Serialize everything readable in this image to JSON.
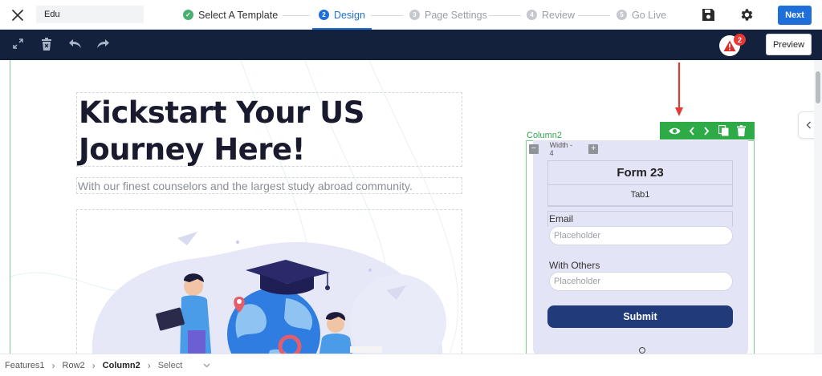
{
  "header": {
    "page_name_value": "Edu",
    "steps": [
      {
        "number": "",
        "label": "Select A Template",
        "state": "done"
      },
      {
        "number": "2",
        "label": "Design",
        "state": "active"
      },
      {
        "number": "3",
        "label": "Page Settings",
        "state": "pending"
      },
      {
        "number": "4",
        "label": "Review",
        "state": "pending"
      },
      {
        "number": "5",
        "label": "Go Live",
        "state": "pending"
      }
    ],
    "next_label": "Next"
  },
  "toolbar": {
    "alert_count": "2",
    "preview_label": "Preview"
  },
  "canvas": {
    "heading": "Kickstart Your US Journey Here!",
    "subheading": "With our finest counselors and the largest study abroad community.",
    "column_label": "Column2",
    "width_label": "Width - 4",
    "form": {
      "title": "Form 23",
      "tab": "Tab1",
      "fields": [
        {
          "label": "Email",
          "placeholder": "Placeholder"
        },
        {
          "label": "With Others",
          "placeholder": "Placeholder"
        }
      ],
      "submit_label": "Submit"
    }
  },
  "breadcrumb": {
    "items": [
      "Features1",
      "Row2",
      "Column2"
    ],
    "select_label": "Select"
  },
  "colors": {
    "accent": "#1e6fd9",
    "toolbar_bg": "#14213d",
    "column_green": "#2eaa46",
    "submit_bg": "#203a7a",
    "alert_red": "#e53935"
  }
}
